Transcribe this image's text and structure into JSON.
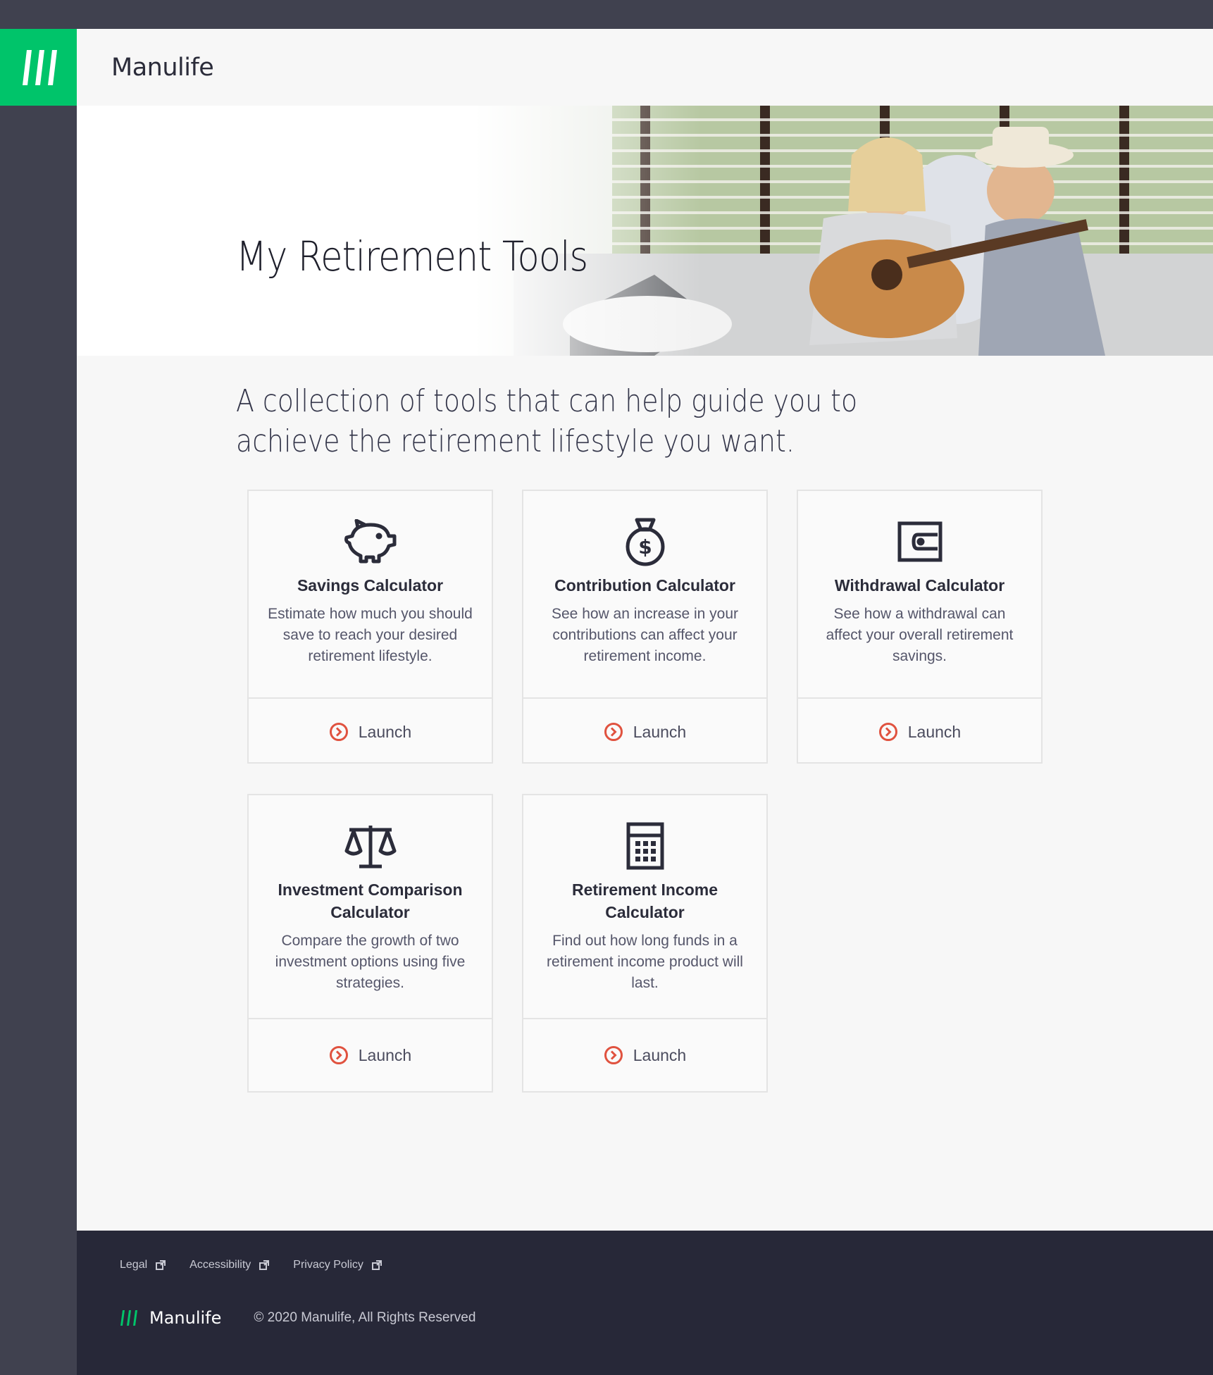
{
  "brand": {
    "name": "Manulife",
    "accent_color": "#00c46a",
    "dark_color": "#40414f"
  },
  "hero": {
    "title": "My Retirement Tools"
  },
  "intro": {
    "text": "A collection of tools that can help guide you to achieve the retirement lifestyle you want."
  },
  "tools": [
    {
      "icon": "piggy-bank-icon",
      "title": "Savings Calculator",
      "description": "Estimate how much you should save to reach your desired retirement lifestyle.",
      "launch_label": "Launch"
    },
    {
      "icon": "money-bag-icon",
      "title": "Contribution Calculator",
      "description": "See how an increase in your contributions can affect your retirement income.",
      "launch_label": "Launch"
    },
    {
      "icon": "wallet-icon",
      "title": "Withdrawal Calculator",
      "description": "See how a withdrawal can affect your overall retirement savings.",
      "launch_label": "Launch"
    },
    {
      "icon": "scales-icon",
      "title": "Investment Comparison Calculator",
      "description": "Compare the growth of two investment options using five strategies.",
      "launch_label": "Launch"
    },
    {
      "icon": "calculator-icon",
      "title": "Retirement Income Calculator",
      "description": "Find out how long funds in a retirement income product will last.",
      "launch_label": "Launch"
    }
  ],
  "launch_icon_color": "#e0523f",
  "footer": {
    "links": [
      {
        "label": "Legal"
      },
      {
        "label": "Accessibility"
      },
      {
        "label": "Privacy Policy"
      }
    ],
    "brand_name": "Manulife",
    "copyright": "© 2020 Manulife, All Rights Reserved"
  }
}
